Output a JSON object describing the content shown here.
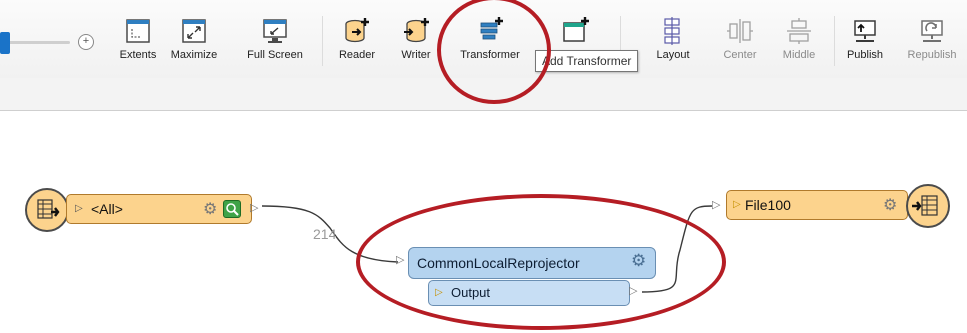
{
  "toolbar": {
    "buttons": [
      {
        "label": "Extents",
        "icon": "extents-icon"
      },
      {
        "label": "Maximize",
        "icon": "maximize-icon"
      },
      {
        "label": "Full Screen",
        "icon": "full-screen-icon"
      },
      {
        "label": "Reader",
        "icon": "reader-icon"
      },
      {
        "label": "Writer",
        "icon": "writer-icon"
      },
      {
        "label": "Transformer",
        "icon": "transformer-icon"
      },
      {
        "label": "Layout",
        "icon": "layout-icon"
      },
      {
        "label": "Center",
        "icon": "center-icon"
      },
      {
        "label": "Middle",
        "icon": "middle-icon"
      },
      {
        "label": "Publish",
        "icon": "publish-icon"
      },
      {
        "label": "Republish",
        "icon": "republish-icon"
      }
    ],
    "zoom_in_symbol": "+",
    "tooltip": "Add Transformer"
  },
  "canvas": {
    "reader_node": {
      "label": "<All>"
    },
    "feature_count": "214",
    "transformer_node": {
      "label": "CommonLocalReprojector",
      "port_label": "Output"
    },
    "writer_node": {
      "label": "File100"
    }
  },
  "colors": {
    "highlight_ellipse": "#b51d24",
    "feature_type_fill": "#fcd38d",
    "transformer_fill": "#b4d3ef",
    "connection_line": "#3a3a3a"
  }
}
